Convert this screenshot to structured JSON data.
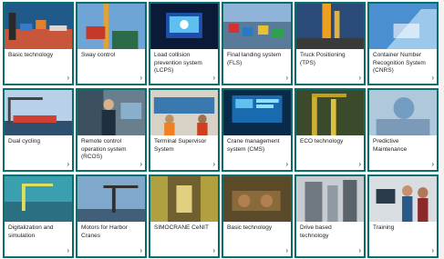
{
  "tiles": [
    {
      "label": "Basic technology",
      "icon": "arrow-right-icon"
    },
    {
      "label": "Sway control",
      "icon": "arrow-right-icon"
    },
    {
      "label": "Load collision prevention system (LCPS)",
      "icon": "arrow-right-icon"
    },
    {
      "label": "Final landing system (FLS)",
      "icon": "arrow-right-icon"
    },
    {
      "label": "Truck Positioning (TPS)",
      "icon": "arrow-right-icon"
    },
    {
      "label": "Container Number Recognition System (CNRS)",
      "icon": "arrow-right-icon"
    },
    {
      "label": "Dual cycling",
      "icon": "arrow-right-icon"
    },
    {
      "label": "Remote control operation system (RCOS)",
      "icon": "arrow-right-icon"
    },
    {
      "label": "Terminal Supervisor System",
      "icon": "arrow-right-icon"
    },
    {
      "label": "Crane management system (CMS)",
      "icon": "arrow-right-icon"
    },
    {
      "label": "ECO technology",
      "icon": "arrow-right-icon"
    },
    {
      "label": "Predictive Maintenance",
      "icon": "arrow-right-icon"
    },
    {
      "label": "Digitalization and simulation",
      "icon": "arrow-right-icon"
    },
    {
      "label": "Motors for Harbor Cranes",
      "icon": "arrow-right-icon"
    },
    {
      "label": "SIMOCRANE CeNIT",
      "icon": "arrow-right-icon"
    },
    {
      "label": "Basic technology",
      "icon": "arrow-right-icon"
    },
    {
      "label": "Drive based technology",
      "icon": "arrow-right-icon"
    },
    {
      "label": "Training",
      "icon": "arrow-right-icon"
    }
  ],
  "arrow_glyph": "›",
  "colors": {
    "tile_border": "#0b6e6e",
    "label_text": "#222222"
  }
}
